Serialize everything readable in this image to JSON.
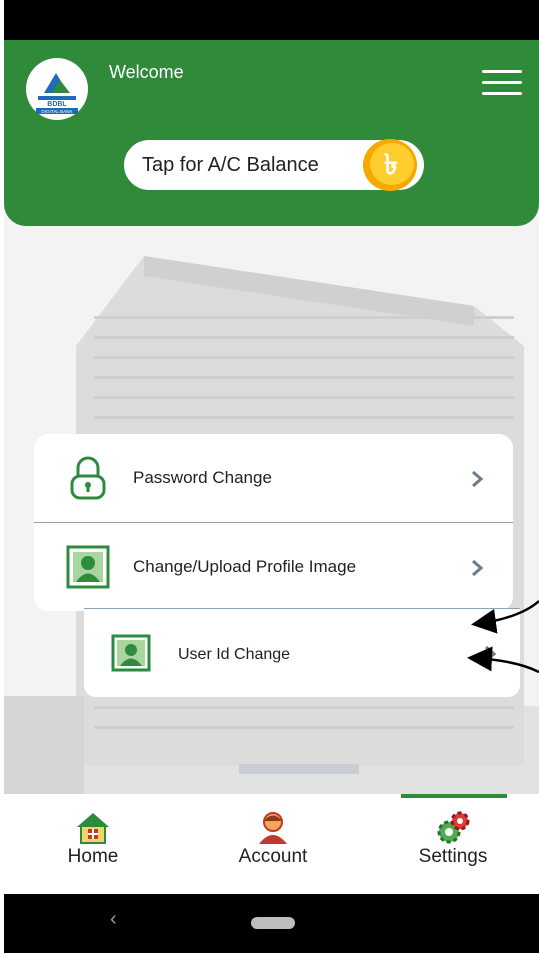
{
  "header": {
    "logo_text_top": "BDBL",
    "logo_text_bottom": "DIGITAL BANK",
    "welcome": "Welcome",
    "balance_button": "Tap for A/C Balance",
    "currency_symbol": "৳"
  },
  "settings_menu": {
    "items": [
      {
        "label": "Password Change",
        "icon": "lock-icon"
      },
      {
        "label": "Change/Upload Profile Image",
        "icon": "profile-image-icon"
      },
      {
        "label": "User Id Change",
        "icon": "user-id-icon"
      }
    ]
  },
  "bottom_nav": {
    "tabs": [
      {
        "label": "Home",
        "icon": "home-icon"
      },
      {
        "label": "Account",
        "icon": "account-icon"
      },
      {
        "label": "Settings",
        "icon": "settings-icon"
      }
    ],
    "active": "Settings"
  },
  "system_nav": {
    "back": "‹"
  },
  "colors": {
    "brand_green": "#2f8b3a",
    "icon_green": "#2e8b3d",
    "coin": "#f7b500"
  }
}
